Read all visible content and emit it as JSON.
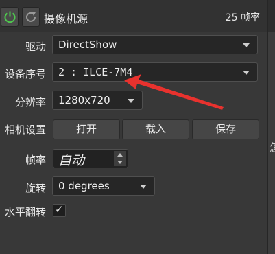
{
  "header": {
    "title": "摄像机源",
    "fps": "25 帧率"
  },
  "rows": {
    "driver": {
      "label": "驱动",
      "value": "DirectShow"
    },
    "device": {
      "label": "设备序号",
      "value": "2 : ILCE-7M4"
    },
    "resolution": {
      "label": "分辨率",
      "value": "1280x720"
    },
    "camera_settings": {
      "label": "相机设置",
      "open": "打开",
      "load": "载入",
      "save": "保存"
    },
    "framerate": {
      "label": "帧率",
      "value": "自动"
    },
    "rotation": {
      "label": "旋转",
      "value": "0 degrees"
    },
    "flip": {
      "label": "水平翻转",
      "checked": true,
      "mark": "✓"
    }
  },
  "right_panel": {
    "glyph": "怎"
  },
  "colors": {
    "power_icon": "#4ec94e",
    "annotation_arrow": "#e8322e"
  },
  "icons": {
    "power": "power-icon",
    "refresh": "refresh-icon"
  }
}
